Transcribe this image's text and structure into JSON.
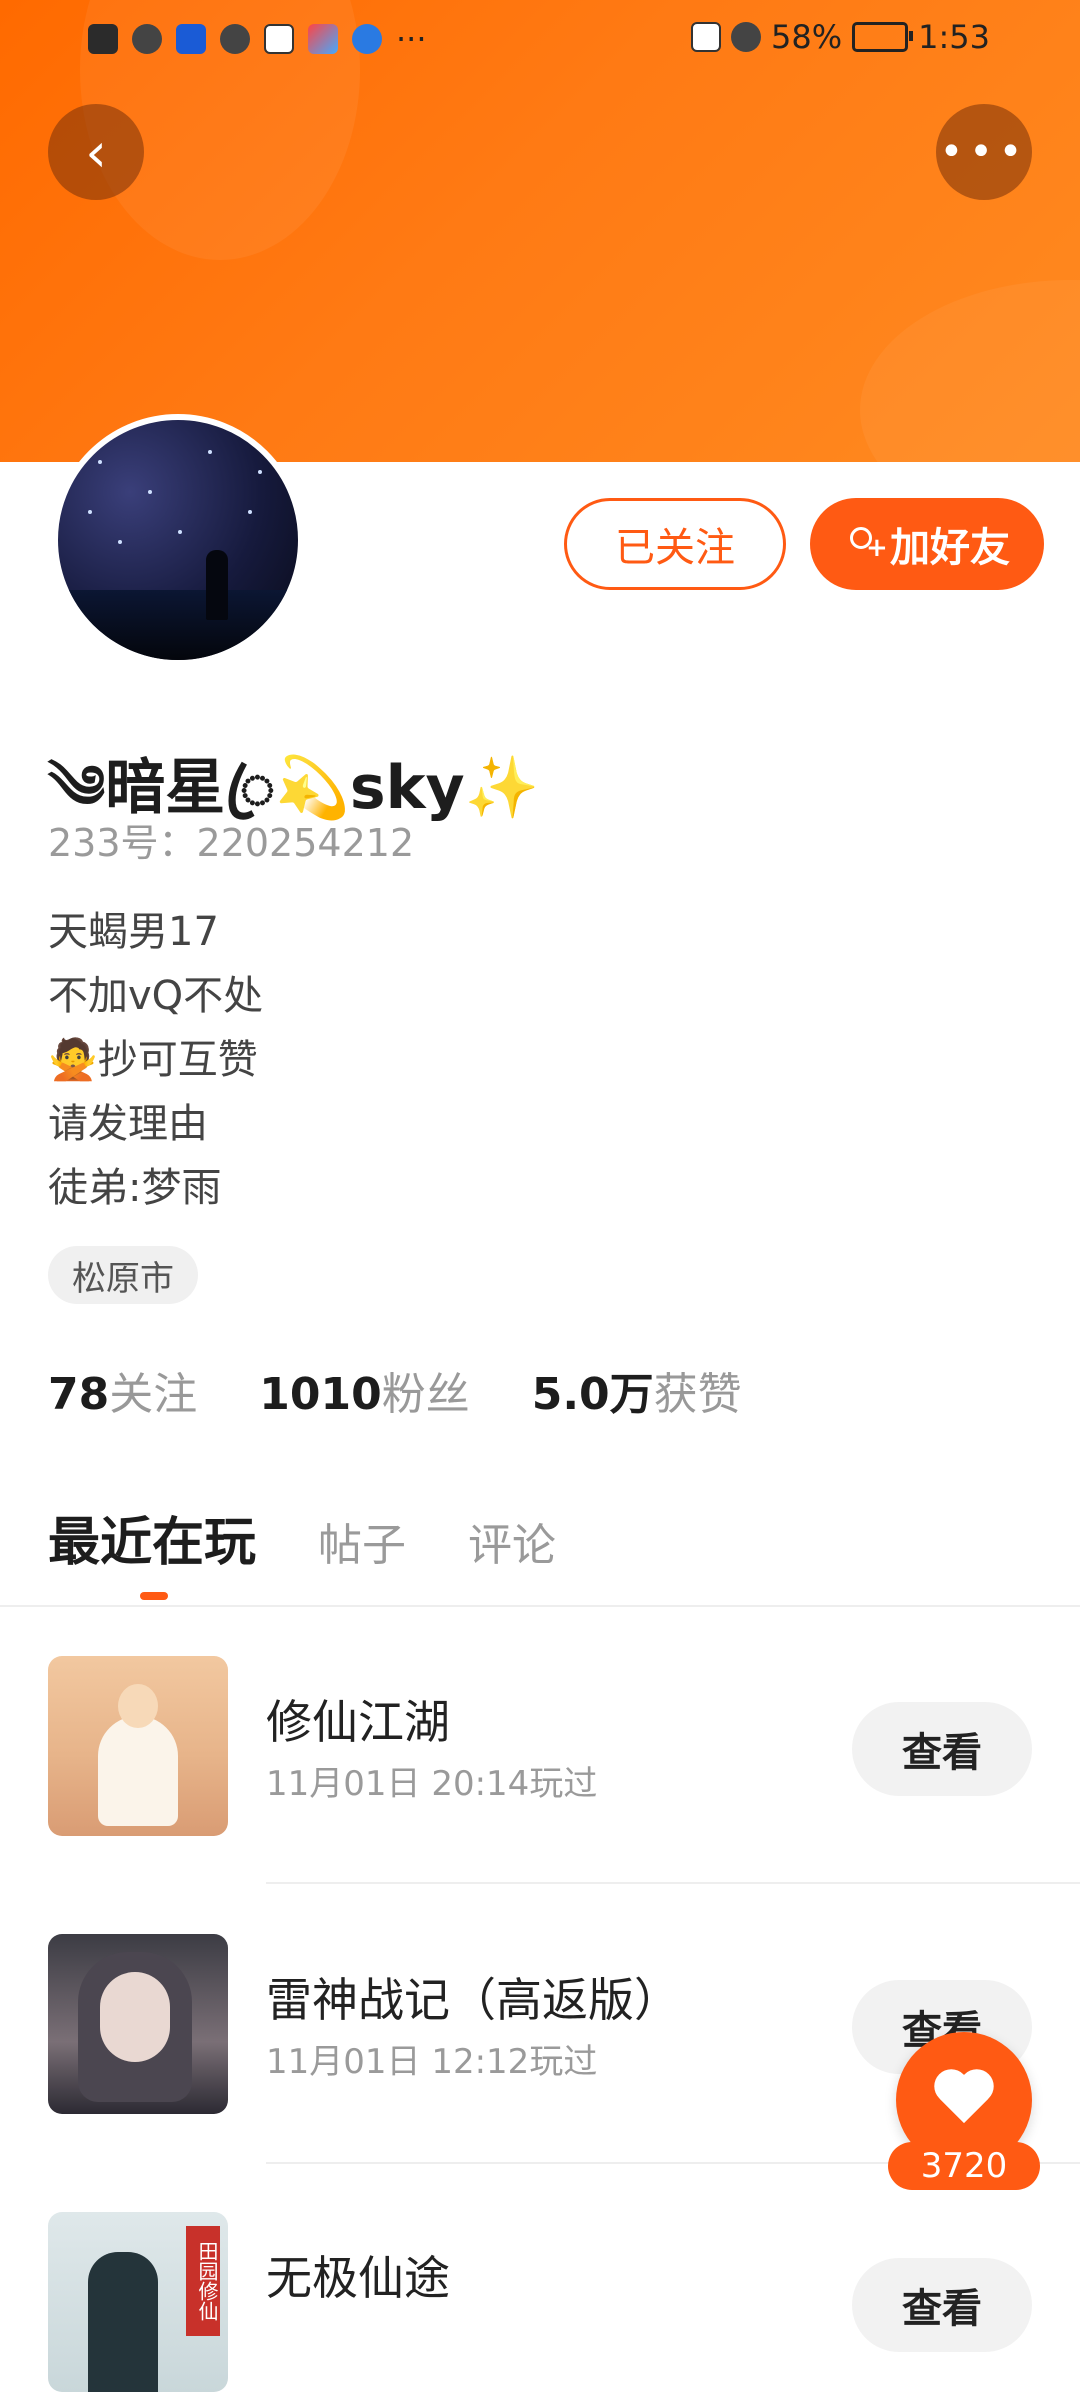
{
  "status_bar": {
    "battery": "58%",
    "time": "1:53",
    "more_glyph": "···"
  },
  "header": {
    "back_icon": "chevron-left-icon",
    "more_icon": "more-horizontal-icon"
  },
  "profile": {
    "follow_label": "已关注",
    "add_friend_label": "加好友",
    "username": "༄暗星ꦿ💫sky✨",
    "uid": "233号：220254212",
    "bio": [
      "天蝎男17",
      "不加vQ不处",
      "🙅抄可互赞",
      "请发理由",
      "徒弟:梦雨"
    ],
    "location": "松原市",
    "stats": [
      {
        "num": "78",
        "label": "关注"
      },
      {
        "num": "1010",
        "label": "粉丝"
      },
      {
        "num": "5.0万",
        "label": "获赞"
      }
    ]
  },
  "tabs": [
    "最近在玩",
    "帖子",
    "评论"
  ],
  "games": [
    {
      "name": "修仙江湖",
      "time": "11月01日 20:14玩过",
      "button": "查看"
    },
    {
      "name": "雷神战记（高返版）",
      "time": "11月01日 12:12玩过",
      "button": "查看"
    },
    {
      "name": "无极仙途",
      "time": "",
      "button": "查看"
    }
  ],
  "thumb3_tag": "田园修仙",
  "like_count": "3720",
  "colors": {
    "accent": "#ff5a13",
    "header": "#ff7a14"
  }
}
